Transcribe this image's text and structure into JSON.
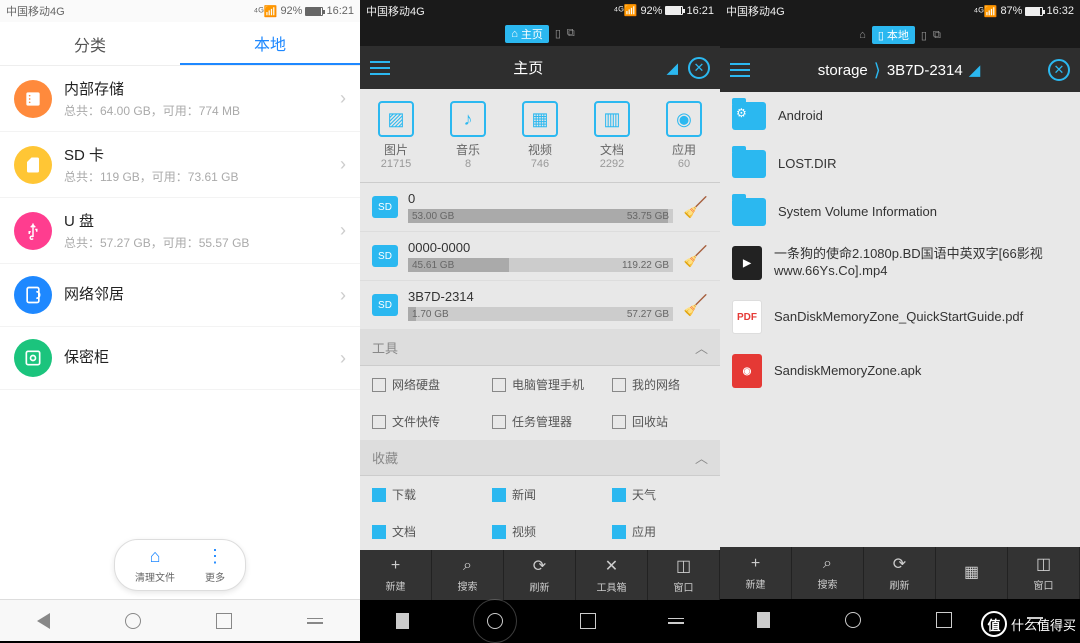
{
  "screen1": {
    "statusbar": {
      "carrier": "中国移动4G",
      "battery": "92%",
      "time": "16:21"
    },
    "tabs": {
      "category": "分类",
      "local": "本地"
    },
    "storage": [
      {
        "title": "内部存储",
        "sub": "总共：64.00 GB，可用：774 MB",
        "color": "#ff8a3c"
      },
      {
        "title": "SD 卡",
        "sub": "总共：119 GB，可用：73.61 GB",
        "color": "#ffc635"
      },
      {
        "title": "U 盘",
        "sub": "总共：57.27 GB，可用：55.57 GB",
        "color": "#ff3d8f"
      },
      {
        "title": "网络邻居",
        "sub": "",
        "color": "#1e88ff"
      },
      {
        "title": "保密柜",
        "sub": "",
        "color": "#1bc47d"
      }
    ],
    "bottom": {
      "clean": "清理文件",
      "more": "更多"
    }
  },
  "screen2": {
    "statusbar": {
      "carrier": "中国移动4G",
      "battery": "92%",
      "time": "16:21"
    },
    "toptab": "主页",
    "header": "主页",
    "categories": [
      {
        "label": "图片",
        "count": "21715"
      },
      {
        "label": "音乐",
        "count": "8"
      },
      {
        "label": "视频",
        "count": "746"
      },
      {
        "label": "文档",
        "count": "2292"
      },
      {
        "label": "应用",
        "count": "60"
      }
    ],
    "drives": [
      {
        "name": "0",
        "used": "53.00 GB",
        "total": "53.75 GB",
        "pct": 98
      },
      {
        "name": "0000-0000",
        "used": "45.61 GB",
        "total": "119.22 GB",
        "pct": 38
      },
      {
        "name": "3B7D-2314",
        "used": "1.70 GB",
        "total": "57.27 GB",
        "pct": 3
      }
    ],
    "sections": {
      "tools": "工具",
      "favs": "收藏"
    },
    "tools": [
      "网络硬盘",
      "电脑管理手机",
      "我的网络",
      "文件快传",
      "任务管理器",
      "回收站"
    ],
    "favs": [
      "下载",
      "新闻",
      "天气",
      "文档",
      "视频",
      "应用"
    ],
    "toolbar": [
      "新建",
      "搜索",
      "刷新",
      "工具箱",
      "窗口"
    ]
  },
  "screen3": {
    "statusbar": {
      "carrier": "中国移动4G",
      "battery": "87%",
      "time": "16:32"
    },
    "toptab": "本地",
    "breadcrumb": {
      "a": "storage",
      "b": "3B7D-2314"
    },
    "files": [
      {
        "name": "Android",
        "type": "folder-gear"
      },
      {
        "name": "LOST.DIR",
        "type": "folder"
      },
      {
        "name": "System Volume Information",
        "type": "folder"
      },
      {
        "name": "一条狗的使命2.1080p.BD国语中英双字[66影视www.66Ys.Co].mp4",
        "type": "video"
      },
      {
        "name": "SanDiskMemoryZone_QuickStartGuide.pdf",
        "type": "pdf"
      },
      {
        "name": "SandiskMemoryZone.apk",
        "type": "apk"
      }
    ],
    "toolbar": [
      "新建",
      "搜索",
      "刷新",
      "",
      "窗口"
    ]
  },
  "watermark": "什么值得买"
}
